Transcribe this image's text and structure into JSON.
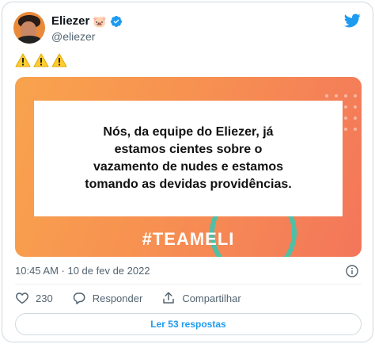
{
  "author": {
    "name": "Eliezer",
    "name_emoji": "🐷",
    "handle": "@eliezer"
  },
  "tweet": {
    "warning_icons": [
      "warning-icon",
      "warning-icon",
      "warning-icon"
    ],
    "media_text": "Nós, da equipe do Eliezer, já\nestamos cientes sobre o\nvazamento de nudes e estamos\ntomando as devidas providências.",
    "media_tag": "#TEAMELI",
    "timestamp": "10:45 AM · 10 de fev de 2022"
  },
  "actions": {
    "likes": "230",
    "reply_label": "Responder",
    "share_label": "Compartilhar"
  },
  "replies_button": "Ler 53 respostas",
  "colors": {
    "twitter_blue": "#1d9bf0",
    "media_orange": "#f79151",
    "ring_teal": "#4fbfa6"
  }
}
